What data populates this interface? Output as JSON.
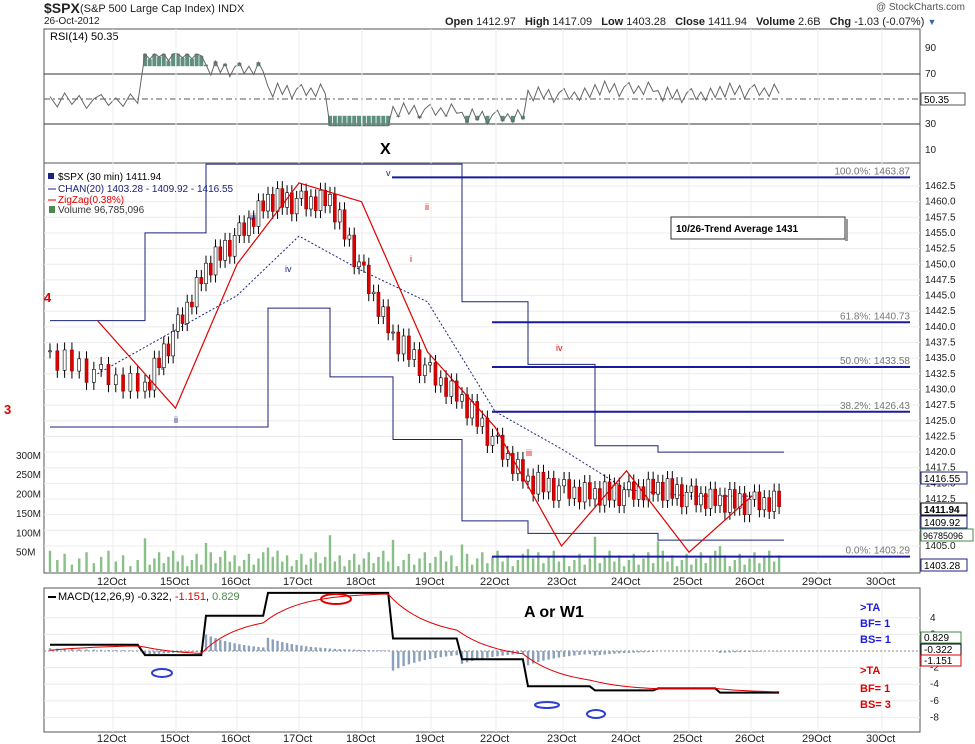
{
  "header": {
    "ticker": "$SPX",
    "name": "(S&P 500 Large Cap Index)",
    "exchange": "INDX",
    "date": "26-Oct-2012",
    "watermark": "@ StockCharts.com",
    "open_label": "Open",
    "open": "1412.97",
    "high_label": "High",
    "high": "1417.09",
    "low_label": "Low",
    "low": "1403.28",
    "close_label": "Close",
    "close": "1411.94",
    "volume_label": "Volume",
    "volume": "2.6B",
    "chg_label": "Chg",
    "chg": "-1.03 (-0.07%)",
    "chg_icon": "triangle-down-icon"
  },
  "colors": {
    "price": "#1a237e",
    "zigzag": "#e00000",
    "volume": "#88c088",
    "channel": "#1a237e",
    "fib": "#1a1aa0",
    "rsi_fill": "#5f8f7f",
    "macd": "#000000",
    "signal": "#e00000",
    "histogram": "#8aa0bb"
  },
  "rsi": {
    "label": "RSI(14) 50.35",
    "value_tag": "50.35",
    "axis": [
      "90",
      "70",
      "50",
      "30",
      "10"
    ]
  },
  "price": {
    "legend": [
      "$SPX (30 min) 1411.94",
      "CHAN(20) 1403.28 - 1409.92 - 1416.55",
      "ZigZag(0.38%)",
      "Volume 96,785,096"
    ],
    "axis": [
      "1462.5",
      "1460.0",
      "1457.5",
      "1455.0",
      "1452.5",
      "1450.0",
      "1447.5",
      "1445.0",
      "1442.5",
      "1440.0",
      "1437.5",
      "1435.0",
      "1432.5",
      "1430.0",
      "1427.5",
      "1425.0",
      "1422.5",
      "1420.0",
      "1417.5",
      "1415.0",
      "1412.5",
      "1410.0",
      "1407.5",
      "1405.0"
    ],
    "vol_axis": [
      "300M",
      "250M",
      "200M",
      "150M",
      "100M",
      "50M"
    ],
    "tags": {
      "chan_upper": "1416.55",
      "close": "1411.94",
      "chan_mid": "1409.92",
      "volume": "96785096",
      "chan_lower": "1403.28"
    },
    "fib_levels": [
      {
        "label": "100.0%: 1463.87",
        "value": 1463.87
      },
      {
        "label": "61.8%: 1440.73",
        "value": 1440.73
      },
      {
        "label": "50.0%: 1433.58",
        "value": 1433.58
      },
      {
        "label": "38.2%: 1426.43",
        "value": 1426.43
      },
      {
        "label": "0.0%: 1403.29",
        "value": 1403.29
      }
    ],
    "annotation_box": "10/26-Trend Average 1431",
    "wave_labels": [
      "X",
      "4",
      "3",
      "iii",
      "iv",
      "ii",
      "i",
      "ii",
      "iv",
      "iii",
      "v",
      "ii",
      "i"
    ]
  },
  "dates": [
    "12Oct",
    "15Oct",
    "16Oct",
    "17Oct",
    "18Oct",
    "19Oct",
    "22Oct",
    "23Oct",
    "24Oct",
    "25Oct",
    "26Oct",
    "29Oct",
    "30Oct"
  ],
  "macd": {
    "label": "MACD(12,26,9)",
    "v1": "-0.322",
    "v2": "-1.151",
    "v3": "0.829",
    "axis": [
      "4",
      "2",
      "0",
      "-2",
      "-4",
      "-6",
      "-8"
    ],
    "tags": [
      "0.829",
      "-0.322",
      "-1.151"
    ],
    "wave_note": "A or W1",
    "notes_blue": [
      ">TA",
      "BF= 1",
      "BS= 1"
    ],
    "notes_red": [
      ">TA",
      "BF= 1",
      "BS= 3"
    ]
  },
  "chart_data": {
    "type": "line",
    "title": "$SPX (S&P 500 Large Cap Index) INDX",
    "x": [
      "12Oct",
      "15Oct",
      "16Oct",
      "17Oct",
      "18Oct",
      "19Oct",
      "22Oct",
      "23Oct",
      "24Oct",
      "25Oct",
      "26Oct"
    ],
    "series": [
      {
        "name": "$SPX (30 min)",
        "values": [
          1435,
          1430,
          1449,
          1460,
          1460,
          1438,
          1428,
          1415,
          1413,
          1414,
          1411.94
        ]
      },
      {
        "name": "ZigZag(0.38%)",
        "values": [
          1441,
          1427,
          1450,
          1463,
          1460,
          1436,
          1424,
          1405,
          1417,
          1404,
          1413
        ]
      }
    ],
    "ylim": [
      1403,
      1465
    ],
    "fibonacci": [
      1463.87,
      1440.73,
      1433.58,
      1426.43,
      1403.29
    ]
  }
}
